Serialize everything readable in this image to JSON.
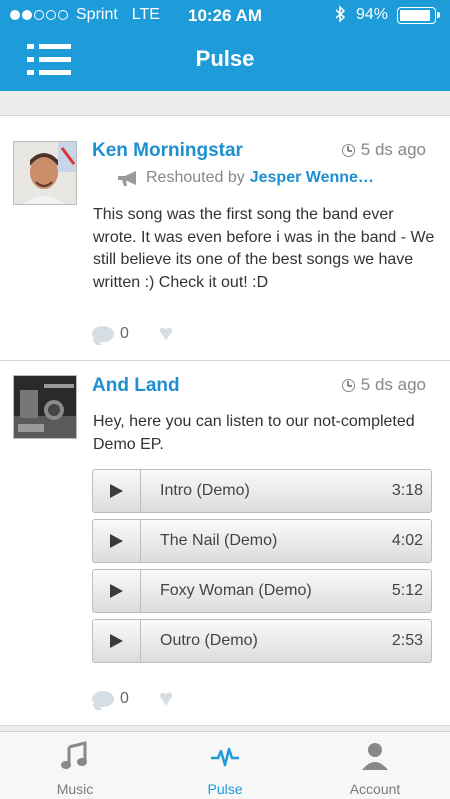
{
  "status_bar": {
    "carrier": "Sprint",
    "network": "LTE",
    "time": "10:26 AM",
    "battery": "94%",
    "signal_bars": 2,
    "signal_total": 5
  },
  "nav": {
    "title": "Pulse",
    "menu_icon": "list-menu-icon"
  },
  "posts": [
    {
      "author": "Ken Morningstar",
      "time": "5 ds ago",
      "reshout_label": "Reshouted by",
      "reshout_by": "Jesper Wenne…",
      "text": "This song was the first song the band ever wrote. It was even before i was in the band - We still believe its one of the best songs we have written :) Check it out! :D",
      "comments": "0"
    },
    {
      "author": "And Land",
      "time": "5 ds ago",
      "text": "Hey, here you can listen to our not-completed Demo EP.",
      "comments": "0",
      "tracks": [
        {
          "name": "Intro (Demo)",
          "duration": "3:18"
        },
        {
          "name": "The Nail (Demo)",
          "duration": "4:02"
        },
        {
          "name": "Foxy Woman (Demo)",
          "duration": "5:12"
        },
        {
          "name": "Outro (Demo)",
          "duration": "2:53"
        }
      ]
    }
  ],
  "tabs": [
    {
      "label": "Music",
      "icon": "music-note-icon"
    },
    {
      "label": "Pulse",
      "icon": "pulse-icon"
    },
    {
      "label": "Account",
      "icon": "user-icon"
    }
  ],
  "colors": {
    "accent": "#1e9bd9",
    "link": "#1e8fd0",
    "muted": "#888888"
  }
}
